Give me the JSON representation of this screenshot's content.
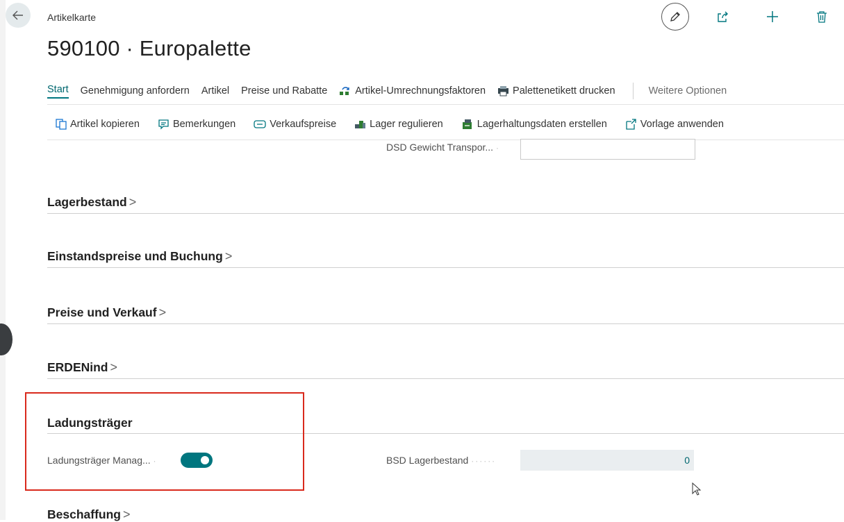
{
  "breadcrumb": "Artikelkarte",
  "title": "590100 · Europalette",
  "tabs": [
    {
      "label": "Start",
      "active": true
    },
    {
      "label": "Genehmigung anfordern"
    },
    {
      "label": "Artikel"
    },
    {
      "label": "Preise und Rabatte"
    },
    {
      "label": "Artikel-Umrechnungsfaktoren",
      "icon": "unit-conversion-icon"
    },
    {
      "label": "Palettenetikett drucken",
      "icon": "print-label-icon"
    }
  ],
  "more_options": "Weitere Optionen",
  "commands": [
    {
      "label": "Artikel kopieren",
      "icon": "copy-icon"
    },
    {
      "label": "Bemerkungen",
      "icon": "comment-icon"
    },
    {
      "label": "Verkaufspreise",
      "icon": "price-tag-icon"
    },
    {
      "label": "Lager regulieren",
      "icon": "adjust-inventory-icon"
    },
    {
      "label": "Lagerhaltungsdaten erstellen",
      "icon": "create-stockkeeping-icon"
    },
    {
      "label": "Vorlage anwenden",
      "icon": "apply-template-icon"
    }
  ],
  "fields": {
    "dsd_gewicht_label": "DSD Gewicht Transpor...",
    "dsd_gewicht_value": "",
    "ladungstraeger_label": "Ladungsträger Manag...",
    "ladungstraeger_on": true,
    "bsd_lagerbestand_label": "BSD Lagerbestand",
    "bsd_lagerbestand_value": "0"
  },
  "sections": {
    "lagerbestand": "Lagerbestand",
    "einstandspreise": "Einstandspreise und Buchung",
    "preise_verkauf": "Preise und Verkauf",
    "erdenind": "ERDENind",
    "ladungstraeger": "Ladungsträger",
    "beschaffung": "Beschaffung"
  },
  "colors": {
    "accent": "#00767f",
    "highlight": "#d9291c"
  }
}
